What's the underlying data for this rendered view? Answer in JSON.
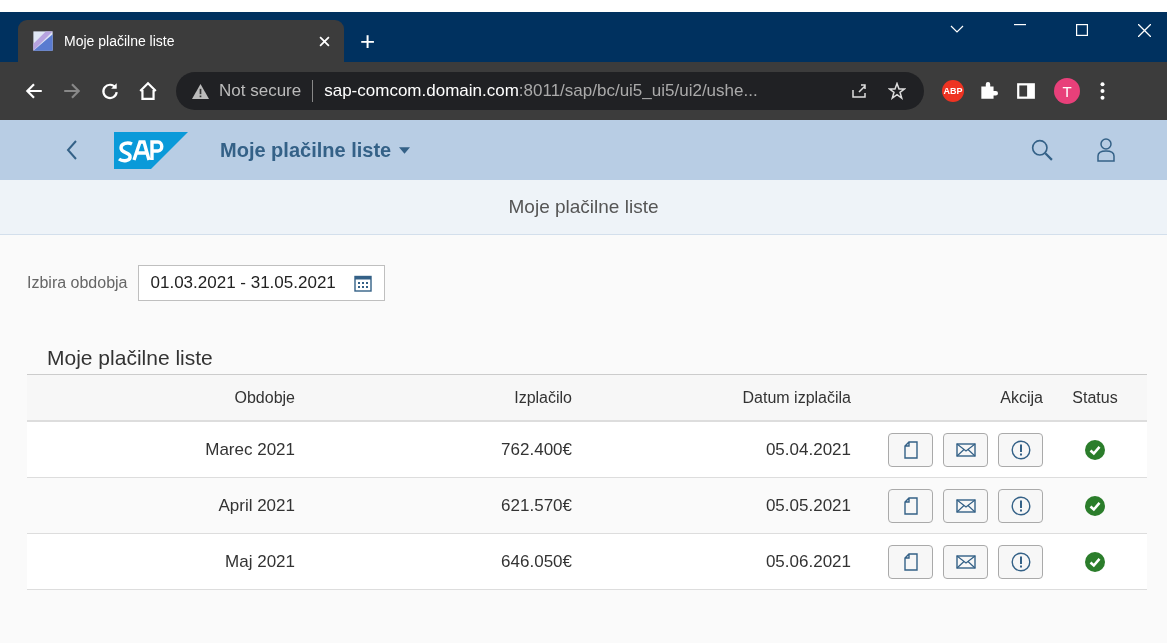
{
  "browser": {
    "tab_title": "Moje plačilne liste",
    "new_tab": "+",
    "security": "Not secure",
    "url_host": "sap-comcom.domain.com",
    "url_rest": ":8011/sap/bc/ui5_ui5/ui2/ushe...",
    "profile_initial": "T",
    "extension_badge": "ABP"
  },
  "shell": {
    "title": "Moje plačilne liste"
  },
  "page": {
    "title": "Moje plačilne liste"
  },
  "filter": {
    "label": "Izbira obdobja",
    "value": "01.03.2021 - 31.05.2021"
  },
  "table": {
    "title": "Moje plačilne liste",
    "columns": [
      "Obdobje",
      "Izplačilo",
      "Datum izplačila",
      "Akcija",
      "Status"
    ],
    "rows": [
      {
        "period": "Marec 2021",
        "amount": "762.400€",
        "date": "05.04.2021",
        "completed": true
      },
      {
        "period": "April 2021",
        "amount": "621.570€",
        "date": "05.05.2021",
        "completed": true
      },
      {
        "period": "Maj 2021",
        "amount": "646.050€",
        "date": "05.06.2021",
        "completed": true
      }
    ]
  }
}
